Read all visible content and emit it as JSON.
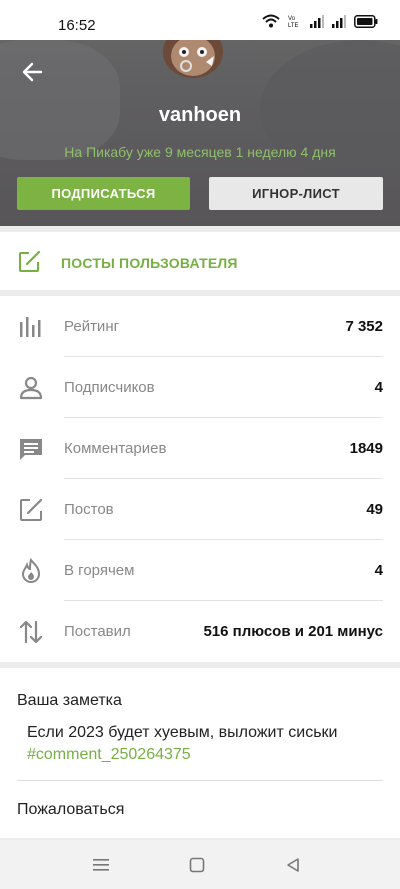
{
  "status_bar": {
    "time": "16:52",
    "icons": [
      "wifi-icon",
      "volte-icon",
      "signal-icon",
      "signal-icon",
      "battery-icon"
    ]
  },
  "profile": {
    "username": "vanhoen",
    "tenure": "На Пикабу уже 9 месяцев 1 неделю 4 дня",
    "subscribe_label": "ПОДПИСАТЬСЯ",
    "ignore_label": "ИГНОР-ЛИСТ"
  },
  "posts_link": {
    "label": "ПОСТЫ ПОЛЬЗОВАТЕЛЯ",
    "icon": "edit-icon"
  },
  "stats": [
    {
      "icon": "bar-chart-icon",
      "name": "Рейтинг",
      "value": "7 352"
    },
    {
      "icon": "person-icon",
      "name": "Подписчиков",
      "value": "4"
    },
    {
      "icon": "comment-icon",
      "name": "Комментариев",
      "value": "1849"
    },
    {
      "icon": "edit-icon",
      "name": "Постов",
      "value": "49"
    },
    {
      "icon": "flame-icon",
      "name": "В горячем",
      "value": "4"
    },
    {
      "icon": "sort-arrows-icon",
      "name": "Поставил",
      "value": "516 плюсов и 201 минус"
    }
  ],
  "note": {
    "title": "Ваша заметка",
    "text": "Если 2023 будет хуевым, выложит сиськи",
    "link": "#comment_250264375"
  },
  "report_label": "Пожаловаться",
  "colors": {
    "accent": "#76b043",
    "subscribe_bg": "#7cb342",
    "tenure": "#8fc06a"
  }
}
